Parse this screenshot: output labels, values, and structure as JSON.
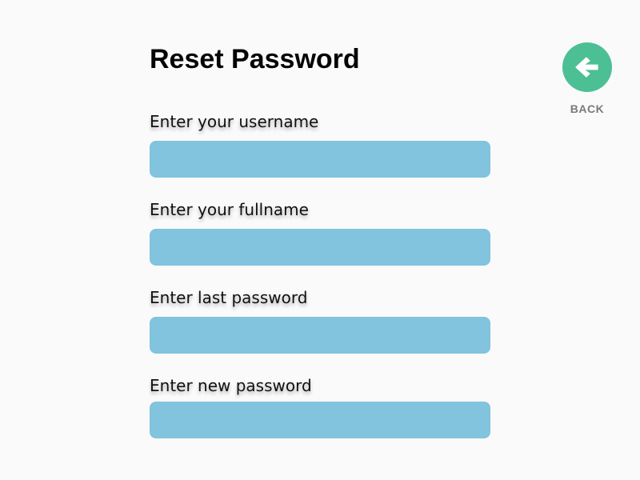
{
  "page": {
    "title": "Reset Password"
  },
  "form": {
    "fields": [
      {
        "label": "Enter your username",
        "value": "",
        "placeholder": ""
      },
      {
        "label": "Enter your fullname",
        "value": "",
        "placeholder": ""
      },
      {
        "label": "Enter last password",
        "value": "",
        "placeholder": ""
      },
      {
        "label": "Enter new password",
        "value": "",
        "placeholder": ""
      }
    ]
  },
  "back": {
    "label": "BACK",
    "icon": "arrow-left-icon"
  },
  "colors": {
    "background": "#fafafa",
    "input_fill": "#82c3de",
    "back_button": "#4dbf95",
    "back_label": "#7a7a7a"
  }
}
